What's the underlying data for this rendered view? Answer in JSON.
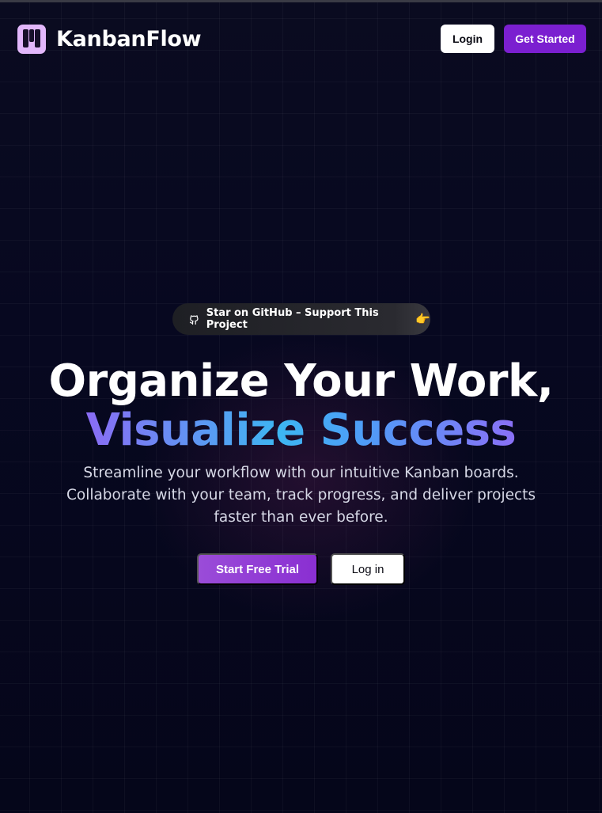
{
  "header": {
    "brand_name": "KanbanFlow",
    "login_label": "Login",
    "get_started_label": "Get Started"
  },
  "badge": {
    "label": "Star on GitHub – Support This Project",
    "icon": "github-icon",
    "emoji": "👉"
  },
  "hero": {
    "title_line1": "Organize Your Work,",
    "title_line2": "Visualize Success",
    "subtitle_line1": "Streamline your workflow with our intuitive Kanban boards.",
    "subtitle_line2": "Collaborate with your team, track progress, and deliver projects",
    "subtitle_line3": "faster than ever before.",
    "primary_cta": "Start Free Trial",
    "secondary_cta": "Log in"
  },
  "colors": {
    "background": "#05061a",
    "accent_purple": "#7b1fd0",
    "logo_bg": "#e2b7fb",
    "gradient_blue": "#3db6f2",
    "gradient_violet": "#8a6cf4"
  }
}
